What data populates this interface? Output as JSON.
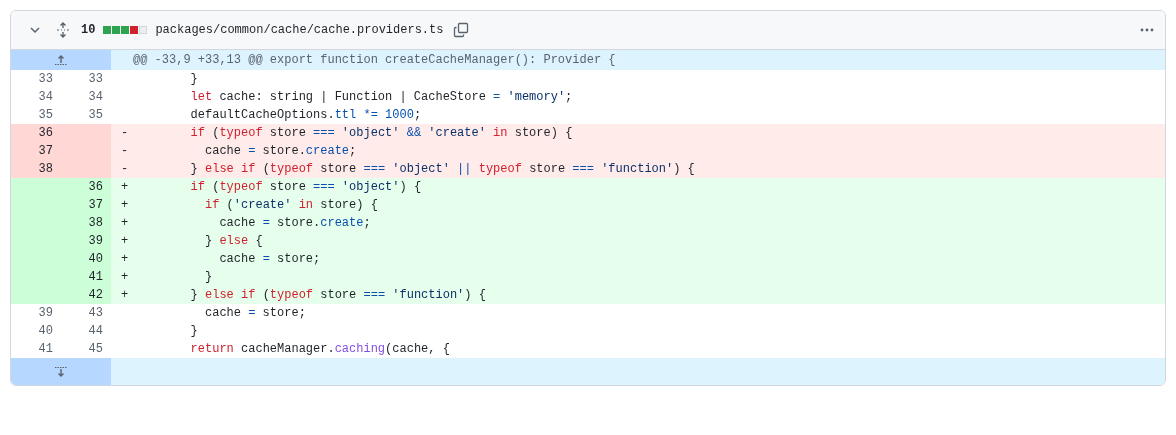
{
  "file": {
    "changes": "10",
    "path": "packages/common/cache/cache.providers.ts",
    "diffstat": [
      {
        "kind": "added"
      },
      {
        "kind": "added"
      },
      {
        "kind": "added"
      },
      {
        "kind": "deleted"
      },
      {
        "kind": "neutral"
      }
    ]
  },
  "hunk": {
    "header": "@@ -33,9 +33,13 @@ export function createCacheManager(): Provider {"
  },
  "lines": [
    {
      "kind": "context",
      "old": "33",
      "new": "33",
      "tokens": [
        {
          "kind": "plain",
          "text": "        }"
        }
      ]
    },
    {
      "kind": "context",
      "old": "34",
      "new": "34",
      "tokens": [
        {
          "kind": "keyword",
          "text": "        let"
        },
        {
          "kind": "plain",
          "text": " cache: string | Function | CacheStore "
        },
        {
          "kind": "operator",
          "text": "="
        },
        {
          "kind": "string",
          "text": " 'memory'"
        },
        {
          "kind": "plain",
          "text": ";"
        }
      ]
    },
    {
      "kind": "context",
      "old": "35",
      "new": "35",
      "tokens": [
        {
          "kind": "plain",
          "text": "        defaultCacheOptions."
        },
        {
          "kind": "property",
          "text": "ttl"
        },
        {
          "kind": "operator",
          "text": " *="
        },
        {
          "kind": "number",
          "text": " 1000"
        },
        {
          "kind": "plain",
          "text": ";"
        }
      ]
    },
    {
      "kind": "deletion",
      "old": "36",
      "marker": "-",
      "tokens": [
        {
          "kind": "keyword",
          "text": "        if"
        },
        {
          "kind": "plain",
          "text": " ("
        },
        {
          "kind": "keyword",
          "text": "typeof"
        },
        {
          "kind": "plain",
          "text": " store "
        },
        {
          "kind": "operator",
          "text": "==="
        },
        {
          "kind": "string",
          "text": " 'object'"
        },
        {
          "kind": "operator",
          "text": " &&"
        },
        {
          "kind": "string",
          "text": " 'create'"
        },
        {
          "kind": "keyword",
          "text": " in"
        },
        {
          "kind": "plain",
          "text": " store) {"
        }
      ]
    },
    {
      "kind": "deletion",
      "old": "37",
      "marker": "-",
      "tokens": [
        {
          "kind": "plain",
          "text": "          cache "
        },
        {
          "kind": "operator",
          "text": "="
        },
        {
          "kind": "plain",
          "text": " store."
        },
        {
          "kind": "property",
          "text": "create"
        },
        {
          "kind": "plain",
          "text": ";"
        }
      ]
    },
    {
      "kind": "deletion",
      "old": "38",
      "marker": "-",
      "tokens": [
        {
          "kind": "plain",
          "text": "        } "
        },
        {
          "kind": "keyword",
          "text": "else if"
        },
        {
          "kind": "plain",
          "text": " ("
        },
        {
          "kind": "keyword",
          "text": "typeof"
        },
        {
          "kind": "plain",
          "text": " store "
        },
        {
          "kind": "operator",
          "text": "==="
        },
        {
          "kind": "string",
          "text": " 'object'"
        },
        {
          "kind": "operator",
          "text": " ||"
        },
        {
          "kind": "keyword",
          "text": " typeof"
        },
        {
          "kind": "plain",
          "text": " store "
        },
        {
          "kind": "operator",
          "text": "==="
        },
        {
          "kind": "string",
          "text": " 'function'"
        },
        {
          "kind": "plain",
          "text": ") {"
        }
      ]
    },
    {
      "kind": "addition",
      "new": "36",
      "marker": "+",
      "tokens": [
        {
          "kind": "keyword",
          "text": "        if"
        },
        {
          "kind": "plain",
          "text": " ("
        },
        {
          "kind": "keyword",
          "text": "typeof"
        },
        {
          "kind": "plain",
          "text": " store "
        },
        {
          "kind": "operator",
          "text": "==="
        },
        {
          "kind": "string",
          "text": " 'object'"
        },
        {
          "kind": "plain",
          "text": ") {"
        }
      ]
    },
    {
      "kind": "addition",
      "new": "37",
      "marker": "+",
      "tokens": [
        {
          "kind": "keyword",
          "text": "          if"
        },
        {
          "kind": "plain",
          "text": " ("
        },
        {
          "kind": "string",
          "text": "'create'"
        },
        {
          "kind": "keyword",
          "text": " in"
        },
        {
          "kind": "plain",
          "text": " store) {"
        }
      ]
    },
    {
      "kind": "addition",
      "new": "38",
      "marker": "+",
      "tokens": [
        {
          "kind": "plain",
          "text": "            cache "
        },
        {
          "kind": "operator",
          "text": "="
        },
        {
          "kind": "plain",
          "text": " store."
        },
        {
          "kind": "property",
          "text": "create"
        },
        {
          "kind": "plain",
          "text": ";"
        }
      ]
    },
    {
      "kind": "addition",
      "new": "39",
      "marker": "+",
      "tokens": [
        {
          "kind": "plain",
          "text": "          } "
        },
        {
          "kind": "keyword",
          "text": "else"
        },
        {
          "kind": "plain",
          "text": " {"
        }
      ]
    },
    {
      "kind": "addition",
      "new": "40",
      "marker": "+",
      "tokens": [
        {
          "kind": "plain",
          "text": "            cache "
        },
        {
          "kind": "operator",
          "text": "="
        },
        {
          "kind": "plain",
          "text": " store;"
        }
      ]
    },
    {
      "kind": "addition",
      "new": "41",
      "marker": "+",
      "tokens": [
        {
          "kind": "plain",
          "text": "          }"
        }
      ]
    },
    {
      "kind": "addition",
      "new": "42",
      "marker": "+",
      "tokens": [
        {
          "kind": "plain",
          "text": "        } "
        },
        {
          "kind": "keyword",
          "text": "else if"
        },
        {
          "kind": "plain",
          "text": " ("
        },
        {
          "kind": "keyword",
          "text": "typeof"
        },
        {
          "kind": "plain",
          "text": " store "
        },
        {
          "kind": "operator",
          "text": "==="
        },
        {
          "kind": "string",
          "text": " 'function'"
        },
        {
          "kind": "plain",
          "text": ") {"
        }
      ]
    },
    {
      "kind": "context",
      "old": "39",
      "new": "43",
      "tokens": [
        {
          "kind": "plain",
          "text": "          cache "
        },
        {
          "kind": "operator",
          "text": "="
        },
        {
          "kind": "plain",
          "text": " store;"
        }
      ]
    },
    {
      "kind": "context",
      "old": "40",
      "new": "44",
      "tokens": [
        {
          "kind": "plain",
          "text": "        }"
        }
      ]
    },
    {
      "kind": "context",
      "old": "41",
      "new": "45",
      "tokens": [
        {
          "kind": "keyword",
          "text": "        return"
        },
        {
          "kind": "plain",
          "text": " cacheManager."
        },
        {
          "kind": "function",
          "text": "caching"
        },
        {
          "kind": "plain",
          "text": "(cache, {"
        }
      ]
    }
  ]
}
